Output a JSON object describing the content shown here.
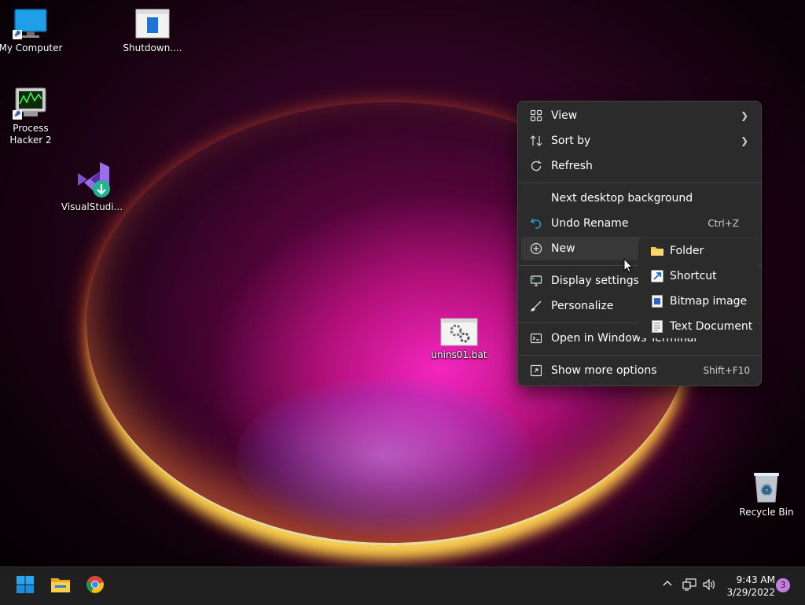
{
  "desktop": {
    "icons": [
      {
        "label": "My Computer"
      },
      {
        "label": "Shutdown...."
      },
      {
        "label": "Process Hacker 2"
      },
      {
        "label": "VisualStudi..."
      },
      {
        "label": "unins01.bat"
      },
      {
        "label": "Recycle Bin"
      }
    ]
  },
  "context_menu": {
    "items": [
      {
        "label": "View",
        "icon": "grid-icon",
        "has_submenu": true
      },
      {
        "label": "Sort by",
        "icon": "sort-icon",
        "has_submenu": true
      },
      {
        "label": "Refresh",
        "icon": "refresh-icon"
      },
      {
        "label": "Next desktop background"
      },
      {
        "label": "Undo Rename",
        "icon": "undo-icon",
        "shortcut": "Ctrl+Z"
      },
      {
        "label": "New",
        "icon": "plus-circle-icon",
        "highlighted": true
      },
      {
        "label": "Display settings",
        "icon": "display-icon"
      },
      {
        "label": "Personalize",
        "icon": "brush-icon"
      },
      {
        "label": "Open in Windows Terminal",
        "icon": "terminal-icon"
      },
      {
        "label": "Show more options",
        "icon": "expand-icon",
        "shortcut": "Shift+F10"
      }
    ]
  },
  "new_submenu": {
    "items": [
      {
        "label": "Folder",
        "icon": "folder-icon"
      },
      {
        "label": "Shortcut",
        "icon": "shortcut-icon"
      },
      {
        "label": "Bitmap image",
        "icon": "bitmap-icon"
      },
      {
        "label": "Text Document",
        "icon": "text-document-icon"
      }
    ]
  },
  "taskbar": {
    "apps": [
      "start-icon",
      "file-explorer-icon",
      "chrome-icon"
    ],
    "tray_icons": [
      "chevron-up-icon",
      "network-icon",
      "volume-icon"
    ],
    "time": "9:43 AM",
    "date": "3/29/2022",
    "notification_count": "3"
  },
  "colors": {
    "menu_bg": "#2b2b2b",
    "taskbar_bg": "#202020",
    "accent": "#c77dde"
  }
}
